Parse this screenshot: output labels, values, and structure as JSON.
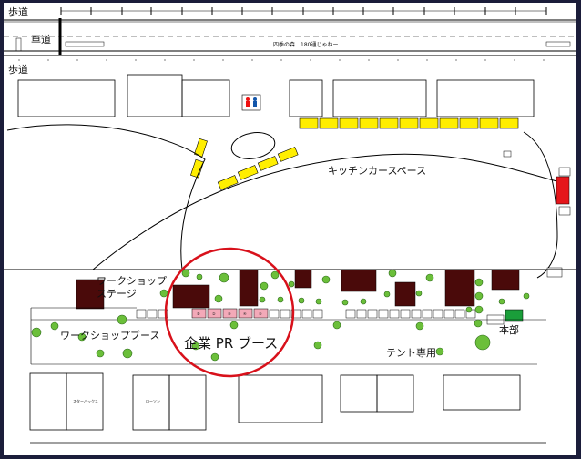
{
  "colors": {
    "pr_circle": "#d8111b",
    "kitchen_car": "#ffee00",
    "booth_dark": "#4a0a0a",
    "tree": "#6bbf3a",
    "pr_booth": "#f3a9b8",
    "red_block": "#e5161b",
    "green_block": "#1a9e3a",
    "background": "#1b1d3a"
  },
  "labels": {
    "sidewalk_top": "歩道",
    "roadway": "車道",
    "road_name": "四季の森　180通じゃねー",
    "sidewalk_left": "歩道",
    "kitchen_car_space": "キッチンカースペース",
    "workshop_stage_line1": "ワークショップ",
    "workshop_stage_line2": "ステージ",
    "workshop_booth": "ワークショップブース",
    "corporate_pr_booth": "企業 PR ブース",
    "tent_only": "テント専用",
    "headquarters": "本部",
    "shops": [
      "ローソン",
      "スターバックス"
    ]
  },
  "icons": [
    "restroom-icon",
    "tree-icon"
  ],
  "pr_booth_numbers": [
    "①",
    "②",
    "③",
    "④",
    "⑤"
  ]
}
